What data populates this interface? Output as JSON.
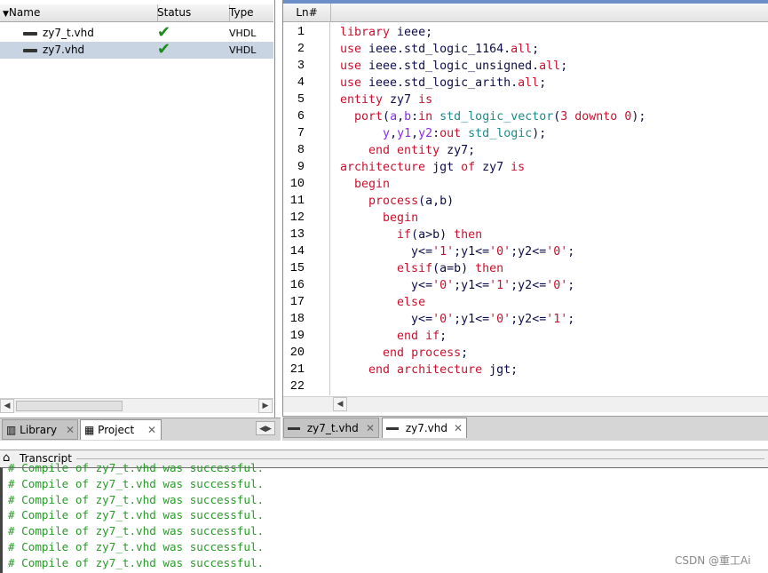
{
  "project": {
    "columns": [
      "Name",
      "Status",
      "Type"
    ],
    "files": [
      {
        "name": "zy7_t.vhd",
        "status": "✔",
        "type": "VHDL",
        "selected": false
      },
      {
        "name": "zy7.vhd",
        "status": "✔",
        "type": "VHDL",
        "selected": true
      }
    ]
  },
  "left_tabs": [
    {
      "label": "Library",
      "icon": "library-icon",
      "active": false
    },
    {
      "label": "Project",
      "icon": "project-icon",
      "active": true
    }
  ],
  "editor": {
    "ln_header": "Ln#",
    "lines": [
      {
        "n": "1",
        "segs": [
          [
            "kw",
            "library "
          ],
          [
            "pl",
            "ieee;"
          ]
        ]
      },
      {
        "n": "2",
        "segs": [
          [
            "kw",
            "use "
          ],
          [
            "pl",
            "ieee.std_logic_1164."
          ],
          [
            "kw",
            "all"
          ],
          [
            "pl",
            ";"
          ]
        ]
      },
      {
        "n": "3",
        "segs": [
          [
            "kw",
            "use "
          ],
          [
            "pl",
            "ieee.std_logic_unsigned."
          ],
          [
            "kw",
            "all"
          ],
          [
            "pl",
            ";"
          ]
        ]
      },
      {
        "n": "4",
        "segs": [
          [
            "kw",
            "use "
          ],
          [
            "pl",
            "ieee.std_logic_arith."
          ],
          [
            "kw",
            "all"
          ],
          [
            "pl",
            ";"
          ]
        ]
      },
      {
        "n": "5",
        "segs": [
          [
            "kw",
            "entity "
          ],
          [
            "pl",
            "zy7 "
          ],
          [
            "kw",
            "is"
          ]
        ]
      },
      {
        "n": "6",
        "segs": [
          [
            "pl",
            "  "
          ],
          [
            "kw",
            "port"
          ],
          [
            "pl",
            "("
          ],
          [
            "nm",
            "a"
          ],
          [
            "pl",
            ","
          ],
          [
            "nm",
            "b"
          ],
          [
            "pl",
            ":"
          ],
          [
            "kw",
            "in "
          ],
          [
            "ty",
            "std_logic_vector"
          ],
          [
            "pl",
            "("
          ],
          [
            "kw",
            "3 "
          ],
          [
            "kw",
            "downto "
          ],
          [
            "kw",
            "0"
          ],
          [
            "pl",
            ");"
          ]
        ]
      },
      {
        "n": "7",
        "segs": [
          [
            "pl",
            "      "
          ],
          [
            "nm",
            "y"
          ],
          [
            "pl",
            ","
          ],
          [
            "nm",
            "y1"
          ],
          [
            "pl",
            ","
          ],
          [
            "nm",
            "y2"
          ],
          [
            "pl",
            ":"
          ],
          [
            "kw",
            "out "
          ],
          [
            "ty",
            "std_logic"
          ],
          [
            "pl",
            ");"
          ]
        ]
      },
      {
        "n": "8",
        "segs": [
          [
            "pl",
            "    "
          ],
          [
            "kw",
            "end entity "
          ],
          [
            "pl",
            "zy7;"
          ]
        ]
      },
      {
        "n": "9",
        "segs": [
          [
            "kw",
            "architecture "
          ],
          [
            "pl",
            "jgt "
          ],
          [
            "kw",
            "of "
          ],
          [
            "pl",
            "zy7 "
          ],
          [
            "kw",
            "is"
          ]
        ]
      },
      {
        "n": "10",
        "segs": [
          [
            "pl",
            "  "
          ],
          [
            "kw",
            "begin"
          ]
        ]
      },
      {
        "n": "11",
        "segs": [
          [
            "pl",
            "    "
          ],
          [
            "kw",
            "process"
          ],
          [
            "pl",
            "(a,b)"
          ]
        ]
      },
      {
        "n": "12",
        "segs": [
          [
            "pl",
            "      "
          ],
          [
            "kw",
            "begin"
          ]
        ]
      },
      {
        "n": "13",
        "segs": [
          [
            "pl",
            "        "
          ],
          [
            "kw",
            "if"
          ],
          [
            "pl",
            "(a>b) "
          ],
          [
            "kw",
            "then"
          ]
        ]
      },
      {
        "n": "14",
        "segs": [
          [
            "pl",
            "          y<="
          ],
          [
            "kw",
            "'1'"
          ],
          [
            "pl",
            ";y1<="
          ],
          [
            "kw",
            "'0'"
          ],
          [
            "pl",
            ";y2<="
          ],
          [
            "kw",
            "'0'"
          ],
          [
            "pl",
            ";"
          ]
        ]
      },
      {
        "n": "15",
        "segs": [
          [
            "pl",
            "        "
          ],
          [
            "kw",
            "elsif"
          ],
          [
            "pl",
            "(a=b) "
          ],
          [
            "kw",
            "then"
          ]
        ]
      },
      {
        "n": "16",
        "segs": [
          [
            "pl",
            "          y<="
          ],
          [
            "kw",
            "'0'"
          ],
          [
            "pl",
            ";y1<="
          ],
          [
            "kw",
            "'1'"
          ],
          [
            "pl",
            ";y2<="
          ],
          [
            "kw",
            "'0'"
          ],
          [
            "pl",
            ";"
          ]
        ]
      },
      {
        "n": "17",
        "segs": [
          [
            "pl",
            "        "
          ],
          [
            "kw",
            "else"
          ]
        ]
      },
      {
        "n": "18",
        "segs": [
          [
            "pl",
            "          y<="
          ],
          [
            "kw",
            "'0'"
          ],
          [
            "pl",
            ";y1<="
          ],
          [
            "kw",
            "'0'"
          ],
          [
            "pl",
            ";y2<="
          ],
          [
            "kw",
            "'1'"
          ],
          [
            "pl",
            ";"
          ]
        ]
      },
      {
        "n": "19",
        "segs": [
          [
            "pl",
            "        "
          ],
          [
            "kw",
            "end if"
          ],
          [
            "pl",
            ";"
          ]
        ]
      },
      {
        "n": "20",
        "segs": [
          [
            "pl",
            "      "
          ],
          [
            "kw",
            "end process"
          ],
          [
            "pl",
            ";"
          ]
        ]
      },
      {
        "n": "21",
        "segs": [
          [
            "pl",
            "    "
          ],
          [
            "kw",
            "end architecture "
          ],
          [
            "pl",
            "jgt;"
          ]
        ]
      },
      {
        "n": "22",
        "segs": []
      }
    ]
  },
  "editor_tabs": [
    {
      "label": "zy7_t.vhd",
      "icon": "vhdl-file-icon",
      "active": false
    },
    {
      "label": "zy7.vhd",
      "icon": "vhdl-file-icon",
      "active": true
    }
  ],
  "transcript": {
    "title": "Transcript",
    "lines": [
      "# Compile of zy7_t.vhd was successful.",
      "# Compile of zy7_t.vhd was successful.",
      "# Compile of zy7_t.vhd was successful.",
      "# Compile of zy7_t.vhd was successful.",
      "# Compile of zy7_t.vhd was successful.",
      "# Compile of zy7_t.vhd was successful.",
      "# Compile of zy7_t.vhd was successful."
    ]
  },
  "watermark": "CSDN @重工Ai",
  "colors": {
    "keyword": "#c8102e",
    "type": "#1b8a8c",
    "signal": "#8a2be2",
    "transcript": "#2a9a2a",
    "selection": "#c9d4e3"
  }
}
